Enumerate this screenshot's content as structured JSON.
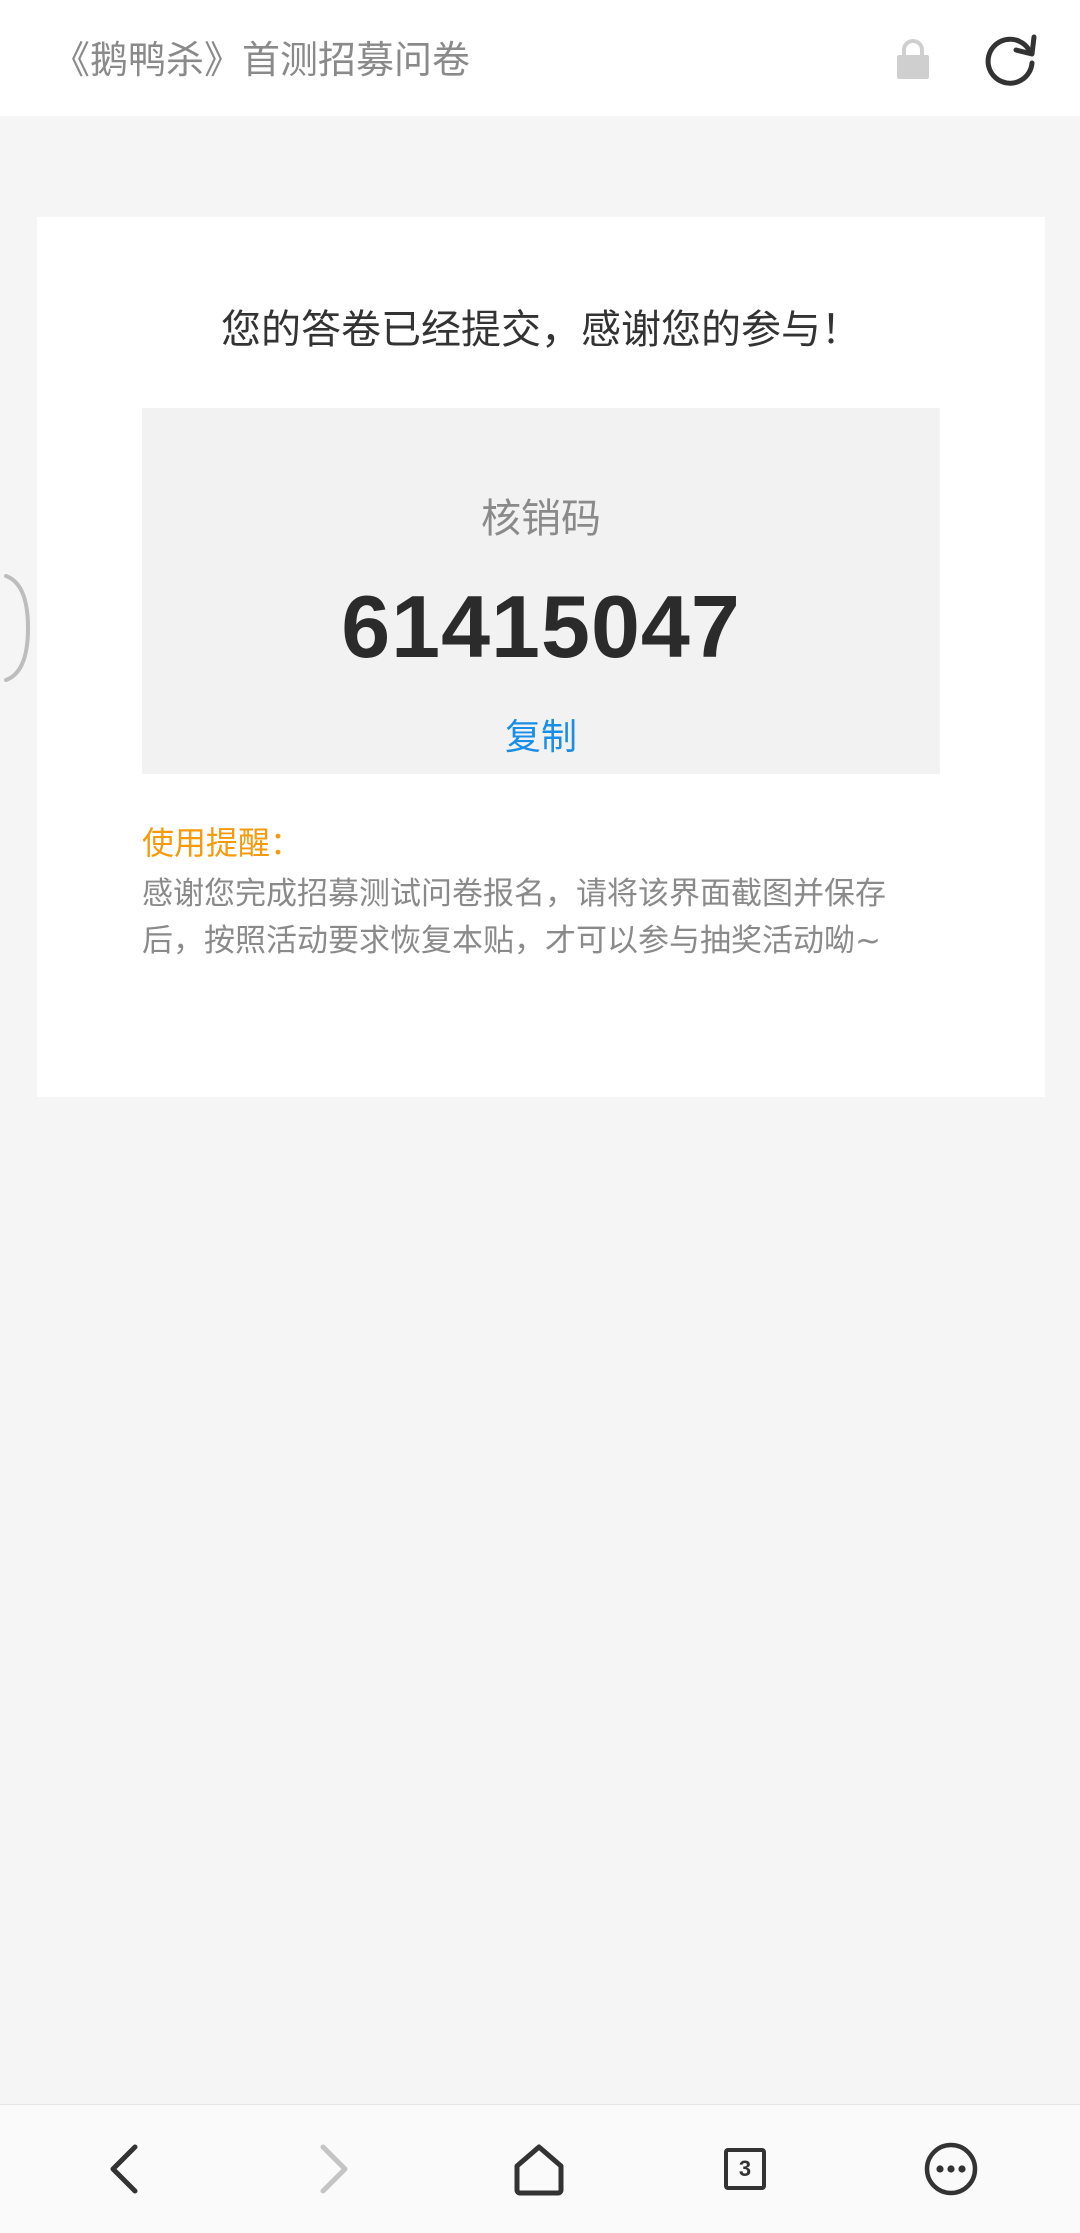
{
  "header": {
    "title": "《鹅鸭杀》首测招募问卷",
    "lock_icon": "lock-icon",
    "refresh_icon": "refresh-icon"
  },
  "card": {
    "success_message": "您的答卷已经提交，感谢您的参与！",
    "code_label": "核销码",
    "code_value": "61415047",
    "copy_label": "复制",
    "reminder_title": "使用提醒：",
    "reminder_text": "感谢您完成招募测试问卷报名，请将该界面截图并保存后，按照活动要求恢复本贴，才可以参与抽奖活动呦~"
  },
  "bottom_nav": {
    "items": [
      {
        "icon": "back-icon"
      },
      {
        "icon": "forward-icon"
      },
      {
        "icon": "home-icon"
      },
      {
        "icon": "tabs-icon",
        "count": "3"
      },
      {
        "icon": "more-icon"
      }
    ]
  },
  "colors": {
    "accent_link": "#1a8ee6",
    "reminder": "#f59a0c",
    "page_background": "#f5f5f5"
  }
}
